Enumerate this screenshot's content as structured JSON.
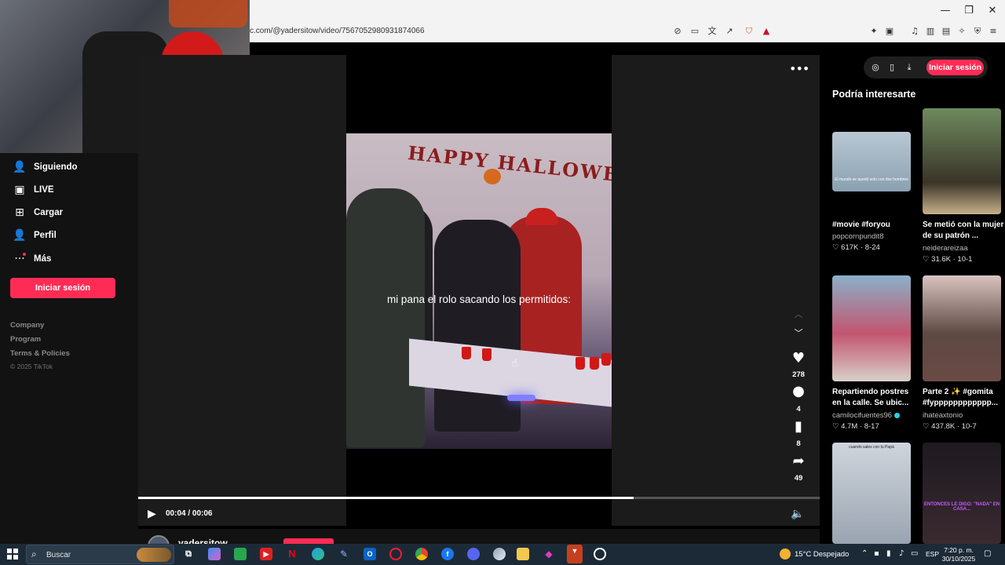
{
  "browser": {
    "url": "c.com/@yadersitow/video/7567052980931874066",
    "window_controls": [
      "—",
      "❐",
      "✕"
    ]
  },
  "leftnav": {
    "items": [
      {
        "label": "Siguiendo",
        "icon": "user-follow-icon"
      },
      {
        "label": "LIVE",
        "icon": "live-tv-icon"
      },
      {
        "label": "Cargar",
        "icon": "upload-plus-icon"
      },
      {
        "label": "Perfil",
        "icon": "profile-icon"
      },
      {
        "label": "Más",
        "icon": "more-dots-icon"
      }
    ],
    "login_label": "Iniciar sesión",
    "footer": [
      "Company",
      "Program",
      "Terms & Policies"
    ],
    "copyright": "© 2025 TikTok"
  },
  "video": {
    "caption": "mi pana el rolo sacando los permitidos:",
    "banner": "HAPPY HALLOWE",
    "time_current": "00:04",
    "time_total": "00:06",
    "timecode": "00:04 / 00:06",
    "progress": 0.727
  },
  "actions": {
    "likes": "278",
    "comments": "4",
    "saves": "8",
    "shares": "49"
  },
  "author": {
    "username": "yadersitow"
  },
  "sidepanel": {
    "login_label": "Iniciar sesión",
    "heading": "Podría interesarte",
    "cards": [
      {
        "title": "#movie #foryou",
        "author": "popcornpundit8",
        "stats": "♡ 617K · 8-24",
        "thumb_text": "El mundo se quedó solo con dos hombres",
        "verified": false
      },
      {
        "title": "Se metió con la mujer de su patrón ...",
        "author": "neiderareizaa",
        "stats": "♡ 31.6K · 10-1",
        "thumb_text": "",
        "verified": false
      },
      {
        "title": "Repartiendo postres en la calle. Se ubic...",
        "author": "camilocifuentes96",
        "stats": "♡ 4.7M · 8-17",
        "thumb_text": "",
        "verified": true
      },
      {
        "title": "Parte 2 ✨ #gomita #fypppppppppppp...",
        "author": "ihateaxtonio",
        "stats": "♡ 437.8K · 10-7",
        "thumb_text": "",
        "verified": false
      },
      {
        "title": "",
        "author": "",
        "stats": "",
        "thumb_text": "cuando sales con tu Papá",
        "verified": false
      },
      {
        "title": "",
        "author": "",
        "stats": "",
        "thumb_text": "ENTONCES LE DIGO: \"NADA\" EN CASA...",
        "verified": false
      }
    ]
  },
  "taskbar": {
    "search_placeholder": "Buscar",
    "weather": "15°C  Despejado",
    "language": "ESP",
    "time": "7:20 p. m.",
    "date": "30/10/2025"
  },
  "colors": {
    "accent": "#fe2c55",
    "background": "#000000",
    "panel": "#121212",
    "taskbar": "#1c2a38"
  }
}
